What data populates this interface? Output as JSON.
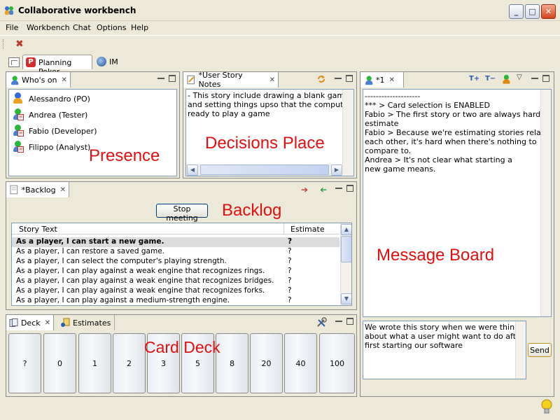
{
  "window": {
    "title": "Collaborative workbench",
    "min": "_",
    "max": "□",
    "close": "✕"
  },
  "menu": [
    "File",
    "Workbench",
    "Chat",
    "Options",
    "Help"
  ],
  "perspectives": [
    {
      "label": "Planning Poker",
      "icon": "planning-poker-icon",
      "active": true
    },
    {
      "label": "IM",
      "icon": "globe-icon",
      "active": false
    }
  ],
  "whos_on": {
    "tab": "Who's on",
    "users": [
      "Alessandro (PO)",
      "Andrea (Tester)",
      "Fabio (Developer)",
      "Filippo (Analyst)"
    ],
    "overlay": "Presence"
  },
  "notes": {
    "tab": "*User Story Notes",
    "text_lines": [
      "- This story include drawing a blank game board",
      "and setting things upso that the computer is",
      "ready to play a game"
    ],
    "overlay": "Decisions Place"
  },
  "backlog": {
    "tab": "*Backlog",
    "stop_button": "Stop meeting",
    "overlay": "Backlog",
    "columns": [
      "Story Text",
      "Estimate"
    ],
    "rows": [
      {
        "story": "As a player, I can start a new game.",
        "estimate": "?",
        "selected": true
      },
      {
        "story": "As a player, I can restore a saved game.",
        "estimate": "?"
      },
      {
        "story": "As a player, I can select the computer's playing strength.",
        "estimate": "?"
      },
      {
        "story": "As a player, I can play against a weak engine that recognizes rings.",
        "estimate": "?"
      },
      {
        "story": "As a player, I can play against a weak engine that recognizes bridges.",
        "estimate": "?"
      },
      {
        "story": "As a player, I can play against a weak engine that recognizes forks.",
        "estimate": "?"
      },
      {
        "story": "As a player, I can play against a medium-strength engine.",
        "estimate": "?"
      }
    ]
  },
  "deck": {
    "tabs": [
      "Deck",
      "Estimates"
    ],
    "overlay": "Card Deck",
    "cards": [
      "?",
      "0",
      "1",
      "2",
      "3",
      "5",
      "8",
      "20",
      "40",
      "100"
    ]
  },
  "chat": {
    "tab": "*1",
    "messages": [
      "--------------------",
      "*** > Card selection is ENABLED",
      "Fabio > The first story or two are always hard to",
      "estimate",
      "Fabio > Because we're estimating stories relative to",
      "each other, it's hard when there's nothing to",
      "compare to.",
      "Andrea > It's not clear what starting a",
      "new game means."
    ],
    "overlay": "Message Board",
    "input_lines": [
      "We wrote this story when we were thinking",
      "about what a user might want to do after",
      "first starting our software"
    ],
    "send": "Send"
  },
  "colors": {
    "overlay": "#e01010",
    "selection": "#dcdcdc"
  }
}
